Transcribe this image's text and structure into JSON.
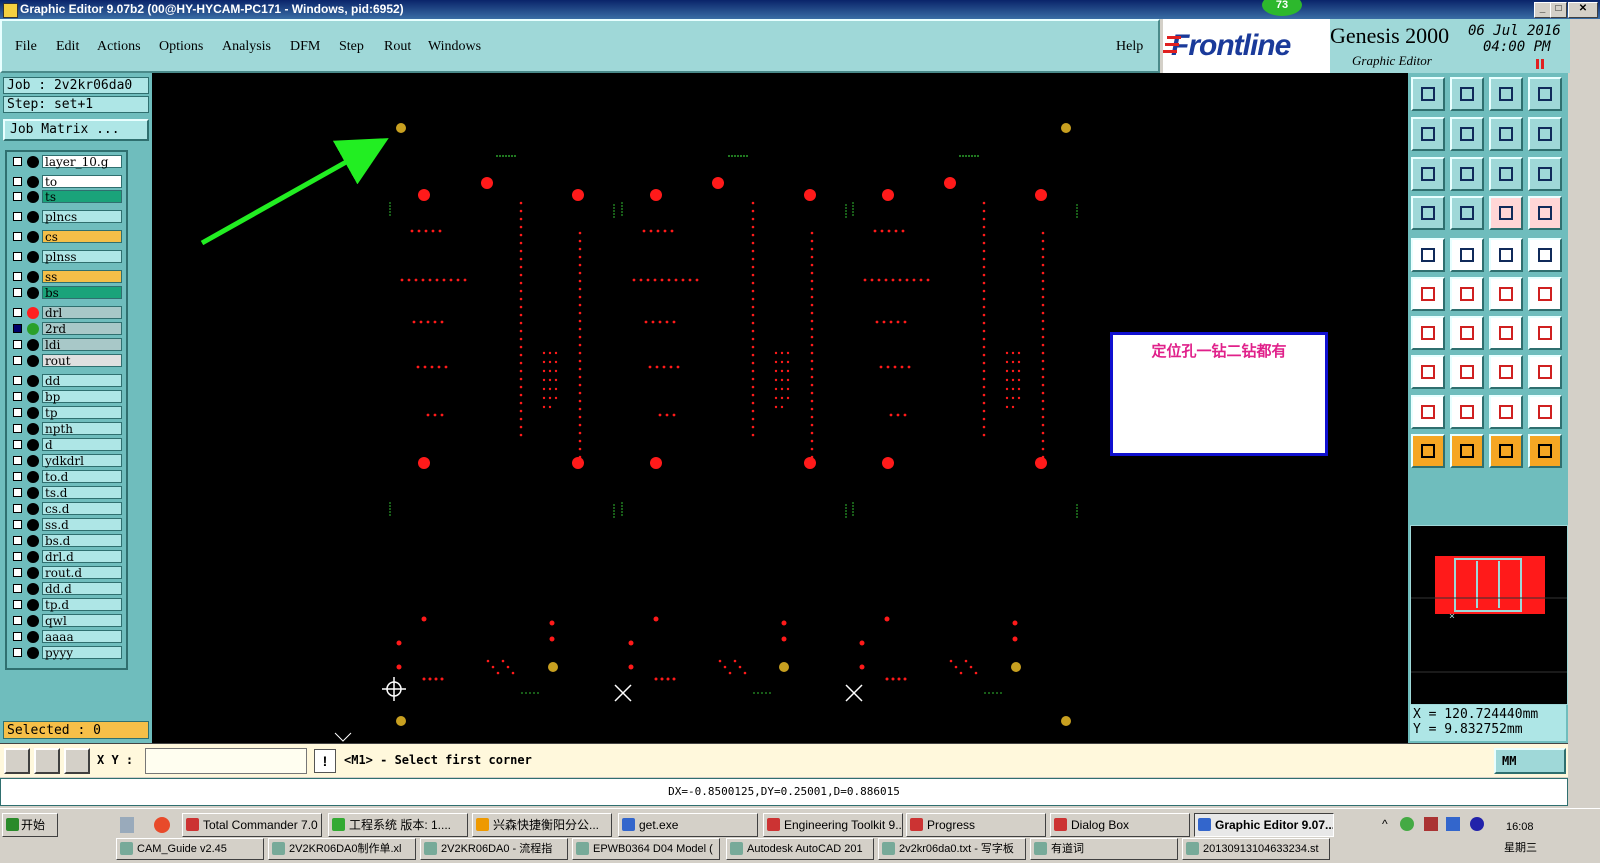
{
  "window": {
    "title": "Graphic Editor 9.07b2 (00@HY-HYCAM-PC171 - Windows, pid:6952)",
    "badge": "73"
  },
  "menu": [
    "File",
    "Edit",
    "Actions",
    "Options",
    "Analysis",
    "DFM",
    "Step",
    "Rout",
    "Windows"
  ],
  "help": "Help",
  "brand": {
    "logo": "Frontline",
    "product": "Genesis 2000",
    "subtitle": "Graphic Editor",
    "date": "06 Jul 2016",
    "time": "04:00 PM"
  },
  "job": {
    "job_line": "Job : 2v2kr06da0",
    "step_line": "Step: set+1",
    "matrix_button": "Job Matrix ..."
  },
  "layers": [
    {
      "name": "layer_10.g",
      "color": "#ffffff",
      "dot": null,
      "checked": false
    },
    {
      "name": "to",
      "color": "#ffffff",
      "dot": null,
      "checked": false
    },
    {
      "name": "ts",
      "color": "#1aa37a",
      "dot": null,
      "checked": false
    },
    {
      "name": "plncs",
      "color": "#aee6e6",
      "dot": null,
      "checked": false
    },
    {
      "name": "cs",
      "color": "#f5bf48",
      "dot": null,
      "checked": false
    },
    {
      "name": "plnss",
      "color": "#aee6e6",
      "dot": null,
      "checked": false
    },
    {
      "name": "ss",
      "color": "#f5bf48",
      "dot": null,
      "checked": false
    },
    {
      "name": "bs",
      "color": "#1aa37a",
      "dot": null,
      "checked": false
    },
    {
      "name": "drl",
      "color": "#a8c8c8",
      "dot": "#ff2020",
      "checked": false
    },
    {
      "name": "2rd",
      "color": "#a8c8c8",
      "dot": "#2aa02a",
      "checked": true
    },
    {
      "name": "ldi",
      "color": "#a8c8c8",
      "dot": null,
      "checked": false
    },
    {
      "name": "rout",
      "color": "#e0e0e0",
      "dot": null,
      "checked": false
    },
    {
      "name": "dd",
      "color": "#aee6e6",
      "dot": null,
      "checked": false
    },
    {
      "name": "bp",
      "color": "#aee6e6",
      "dot": null,
      "checked": false
    },
    {
      "name": "tp",
      "color": "#aee6e6",
      "dot": null,
      "checked": false
    },
    {
      "name": "npth",
      "color": "#aee6e6",
      "dot": null,
      "checked": false
    },
    {
      "name": "d",
      "color": "#aee6e6",
      "dot": null,
      "checked": false
    },
    {
      "name": "ydkdrl",
      "color": "#aee6e6",
      "dot": null,
      "checked": false
    },
    {
      "name": "to.d",
      "color": "#aee6e6",
      "dot": null,
      "checked": false
    },
    {
      "name": "ts.d",
      "color": "#aee6e6",
      "dot": null,
      "checked": false
    },
    {
      "name": "cs.d",
      "color": "#aee6e6",
      "dot": null,
      "checked": false
    },
    {
      "name": "ss.d",
      "color": "#aee6e6",
      "dot": null,
      "checked": false
    },
    {
      "name": "bs.d",
      "color": "#aee6e6",
      "dot": null,
      "checked": false
    },
    {
      "name": "drl.d",
      "color": "#aee6e6",
      "dot": null,
      "checked": false
    },
    {
      "name": "rout.d",
      "color": "#aee6e6",
      "dot": null,
      "checked": false
    },
    {
      "name": "dd.d",
      "color": "#aee6e6",
      "dot": null,
      "checked": false
    },
    {
      "name": "tp.d",
      "color": "#aee6e6",
      "dot": null,
      "checked": false
    },
    {
      "name": "qwl",
      "color": "#aee6e6",
      "dot": null,
      "checked": false
    },
    {
      "name": "aaaa",
      "color": "#aee6e6",
      "dot": null,
      "checked": false
    },
    {
      "name": "pyyy",
      "color": "#aee6e6",
      "dot": null,
      "checked": false
    }
  ],
  "selected": "Selected : 0",
  "annotation": "定位孔一钻二钻都有",
  "coords": {
    "x": "X = 120.724440mm",
    "y": "Y = 9.832752mm"
  },
  "cmd": {
    "xy_label": "X Y :",
    "input_value": "",
    "prompt": "<M1> - Select first corner",
    "units": "MM"
  },
  "status": "DX=-0.8500125,DY=0.25001,D=0.886015",
  "taskbar": {
    "start": "开始",
    "tasks": [
      "Total Commander 7.0 ...",
      "工程系统  版本: 1....",
      "兴森快捷衡阳分公...",
      "get.exe",
      "Engineering Toolkit 9....",
      "Progress",
      "Dialog Box",
      "Graphic Editor 9.07..."
    ],
    "tasks2": [
      "CAM_Guide v2.45",
      "2V2KR06DA0制作单.xl",
      "2V2KR06DA0 - 流程指",
      "EPWB0364 D04 Model (",
      "Autodesk AutoCAD 201",
      "2v2kr06da0.txt - 写字板",
      "有道词",
      "20130913104633234.st"
    ],
    "clock": "16:08",
    "day": "星期三"
  },
  "colors": {
    "accent": "#9fd8d8",
    "drill": "#ff1a1a",
    "fiducial": "#c8a020",
    "arrow": "#22ee22",
    "green_pads": "#2aa02a"
  }
}
